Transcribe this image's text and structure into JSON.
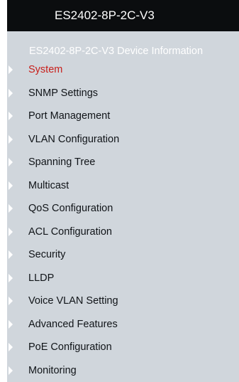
{
  "header": {
    "title": "ES2402-8P-2C-V3"
  },
  "sidebar": {
    "device_link": "ES2402-8P-2C-V3 Device Information",
    "items": [
      {
        "label": "System",
        "active": true
      },
      {
        "label": "SNMP Settings",
        "active": false
      },
      {
        "label": "Port Management",
        "active": false
      },
      {
        "label": "VLAN Configuration",
        "active": false
      },
      {
        "label": "Spanning Tree",
        "active": false
      },
      {
        "label": "Multicast",
        "active": false
      },
      {
        "label": "QoS Configuration",
        "active": false
      },
      {
        "label": "ACL Configuration",
        "active": false
      },
      {
        "label": "Security",
        "active": false
      },
      {
        "label": "LLDP",
        "active": false
      },
      {
        "label": "Voice VLAN Setting",
        "active": false
      },
      {
        "label": "Advanced Features",
        "active": false
      },
      {
        "label": "PoE Configuration",
        "active": false
      },
      {
        "label": "Monitoring",
        "active": false
      }
    ]
  },
  "colors": {
    "header_bg": "#0b0d0f",
    "sidebar_bg": "#d0d6dc",
    "active_text": "#c8201c",
    "arrow": "#ffffff"
  }
}
